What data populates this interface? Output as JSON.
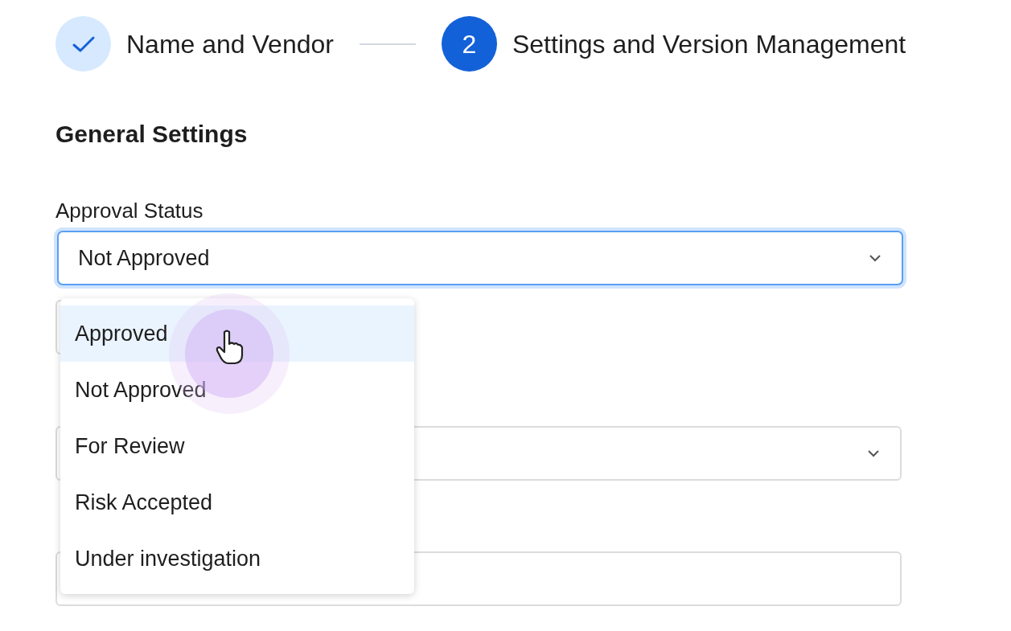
{
  "stepper": {
    "steps": [
      {
        "kind": "done",
        "label": "Name and Vendor"
      },
      {
        "kind": "current",
        "number": "2",
        "label": "Settings and Version Management"
      }
    ]
  },
  "section_title": "General Settings",
  "approval_status": {
    "label": "Approval Status",
    "value": "Not Approved",
    "open": true,
    "options": [
      {
        "label": "Approved",
        "highlighted": true
      },
      {
        "label": "Not Approved",
        "highlighted": false
      },
      {
        "label": "For Review",
        "highlighted": false
      },
      {
        "label": "Risk Accepted",
        "highlighted": false
      },
      {
        "label": "Under investigation",
        "highlighted": false
      }
    ]
  },
  "fields_below": [
    {
      "kind": "stub"
    },
    {
      "kind": "select"
    },
    {
      "kind": "input"
    }
  ]
}
